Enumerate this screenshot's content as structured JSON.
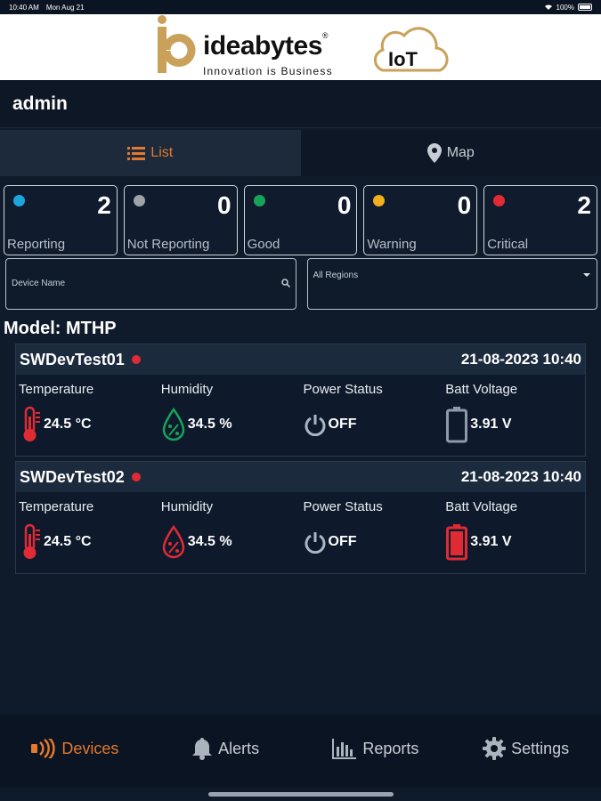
{
  "status": {
    "time": "10:40 AM",
    "date": "Mon Aug 21",
    "battery": "100%"
  },
  "header": {
    "brand": "ideabytes",
    "tagline": "Innovation is Business",
    "iot": "IoT",
    "user": "admin"
  },
  "view_toggle": {
    "list": "List",
    "map": "Map",
    "active": "List"
  },
  "stats": [
    {
      "label": "Reporting",
      "count": "2",
      "color": "#1ca6dc"
    },
    {
      "label": "Not Reporting",
      "count": "0",
      "color": "#9ea3a8"
    },
    {
      "label": "Good",
      "count": "0",
      "color": "#17a35a"
    },
    {
      "label": "Warning",
      "count": "0",
      "color": "#f2b11c"
    },
    {
      "label": "Critical",
      "count": "2",
      "color": "#e02b34"
    }
  ],
  "filters": {
    "device_placeholder": "Device Name",
    "region_selected": "All Regions"
  },
  "model": "Model: MTHP",
  "devices": [
    {
      "name": "SWDevTest01",
      "timestamp": "21-08-2023 10:40",
      "metrics": [
        {
          "label": "Temperature",
          "value": "24.5 °C"
        },
        {
          "label": "Humidity",
          "value": "34.5 %"
        },
        {
          "label": "Power Status",
          "value": "OFF"
        },
        {
          "label": "Batt Voltage",
          "value": "3.91 V"
        }
      ]
    },
    {
      "name": "SWDevTest02",
      "timestamp": "21-08-2023 10:40",
      "metrics": [
        {
          "label": "Temperature",
          "value": "24.5 °C"
        },
        {
          "label": "Humidity",
          "value": "34.5 %"
        },
        {
          "label": "Power Status",
          "value": "OFF"
        },
        {
          "label": "Batt Voltage",
          "value": "3.91 V"
        }
      ]
    }
  ],
  "tabs": [
    {
      "label": "Devices",
      "icon": "devices-icon",
      "active": true
    },
    {
      "label": "Alerts",
      "icon": "bell-icon"
    },
    {
      "label": "Reports",
      "icon": "reports-icon"
    },
    {
      "label": "Settings",
      "icon": "gear-icon"
    }
  ],
  "colors": {
    "accent": "#e4782e",
    "critical": "#e02b34",
    "good": "#17a35a"
  }
}
